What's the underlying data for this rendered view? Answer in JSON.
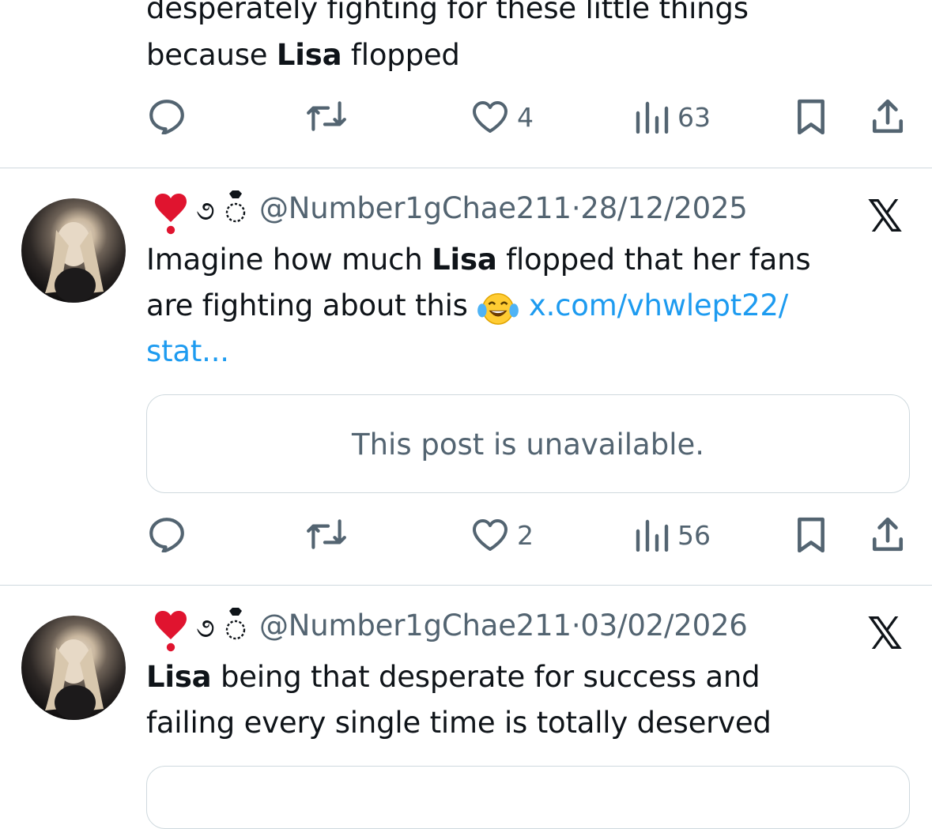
{
  "tweet0": {
    "line1": "desperately fighting for these little things",
    "line2_pre": "because ",
    "line2_bold": "Lisa",
    "line2_post": " flopped",
    "likes": "4",
    "views": "63"
  },
  "tweet1": {
    "handle": "@Number1gChae211",
    "dot": "·",
    "date": "28/12/2025",
    "text_pre": "Imagine how much ",
    "text_bold": "Lisa",
    "text_post_1": " flopped that her fans",
    "text_line2": "are fighting about this",
    "link_1": "x.com/vhwlept22/",
    "link_2": "stat...",
    "card": "This post is unavailable.",
    "likes": "2",
    "views": "56"
  },
  "tweet2": {
    "handle": "@Number1gChae211",
    "dot": "·",
    "date": "03/02/2026",
    "text_bold": "Lisa",
    "text_post_1": " being that desperate for success and",
    "text_line2": "failing every single time is totally deserved"
  },
  "colors": {
    "text": "#0f1419",
    "secondary": "#536471",
    "link": "#1d9bf0",
    "border": "#cfd9de"
  },
  "icons": [
    "reply-icon",
    "retweet-icon",
    "like-icon",
    "views-icon",
    "bookmark-icon",
    "share-icon",
    "x-logo-icon",
    "heart-emoji-icon",
    "ring-icon",
    "laughing-emoji-icon"
  ]
}
